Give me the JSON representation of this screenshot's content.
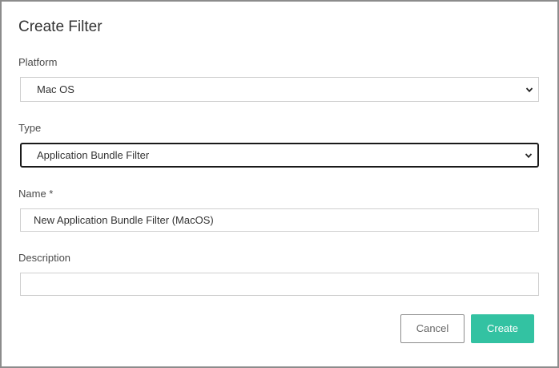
{
  "dialog": {
    "title": "Create Filter"
  },
  "form": {
    "platform": {
      "label": "Platform",
      "selected": "Mac OS"
    },
    "type": {
      "label": "Type",
      "selected": "Application Bundle Filter"
    },
    "name": {
      "label": "Name *",
      "value": "New Application Bundle Filter (MacOS)"
    },
    "description": {
      "label": "Description",
      "value": ""
    }
  },
  "actions": {
    "cancel_label": "Cancel",
    "create_label": "Create"
  },
  "colors": {
    "accent": "#33c2a2",
    "border": "#cfcfcf",
    "focus_border": "#1a1a1a"
  }
}
